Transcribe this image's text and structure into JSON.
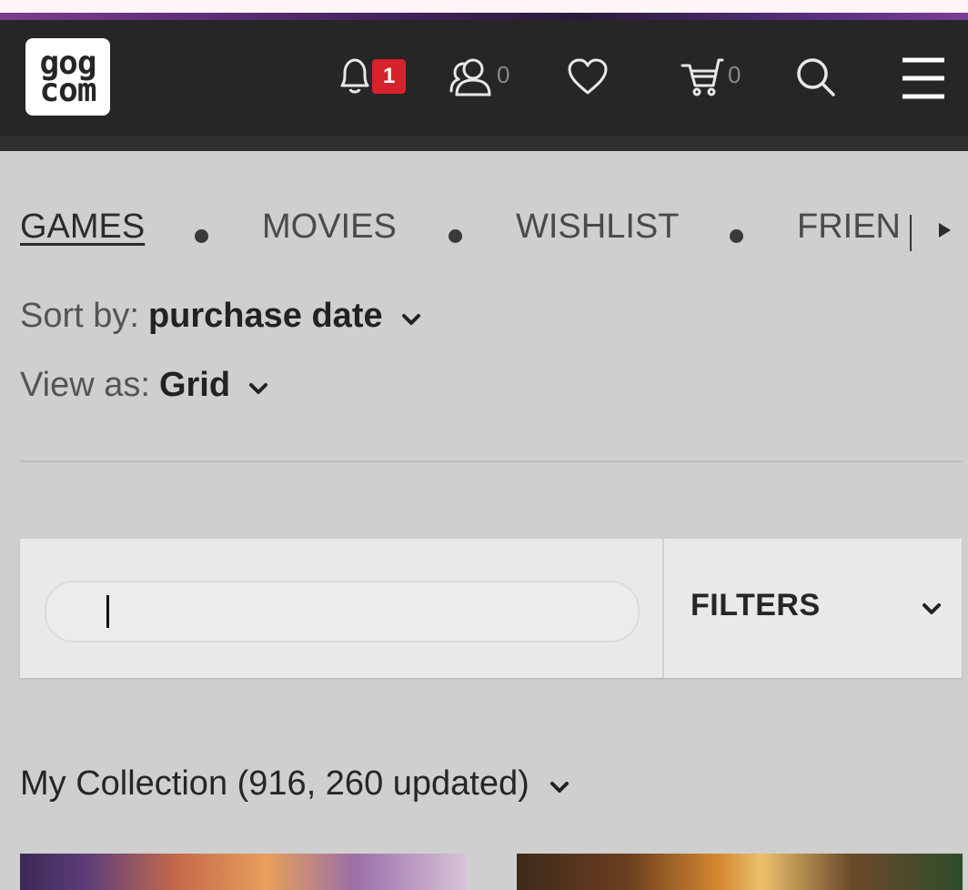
{
  "header": {
    "logo_line1": "gog",
    "logo_line2": "com",
    "notifications": {
      "icon": "bell-icon",
      "badge": "1"
    },
    "friends": {
      "icon": "friends-icon",
      "count": "0"
    },
    "wishlist": {
      "icon": "heart-icon"
    },
    "cart": {
      "icon": "cart-icon",
      "count": "0"
    },
    "search": {
      "icon": "search-icon"
    },
    "menu": {
      "icon": "hamburger-menu-icon"
    }
  },
  "tabs": [
    {
      "label": "GAMES",
      "active": true
    },
    {
      "label": "MOVIES",
      "active": false
    },
    {
      "label": "WISHLIST",
      "active": false
    },
    {
      "label": "FRIEN",
      "active": false
    }
  ],
  "sort": {
    "label": "Sort by:",
    "value": "purchase date"
  },
  "view": {
    "label": "View as:",
    "value": "Grid"
  },
  "search": {
    "value": "",
    "placeholder": ""
  },
  "filters": {
    "label": "FILTERS"
  },
  "collection": {
    "title": "My Collection (916, 260 updated)"
  },
  "colors": {
    "header_bg": "#262626",
    "badge": "#d6222a",
    "page_bg": "#cfcfcf"
  }
}
